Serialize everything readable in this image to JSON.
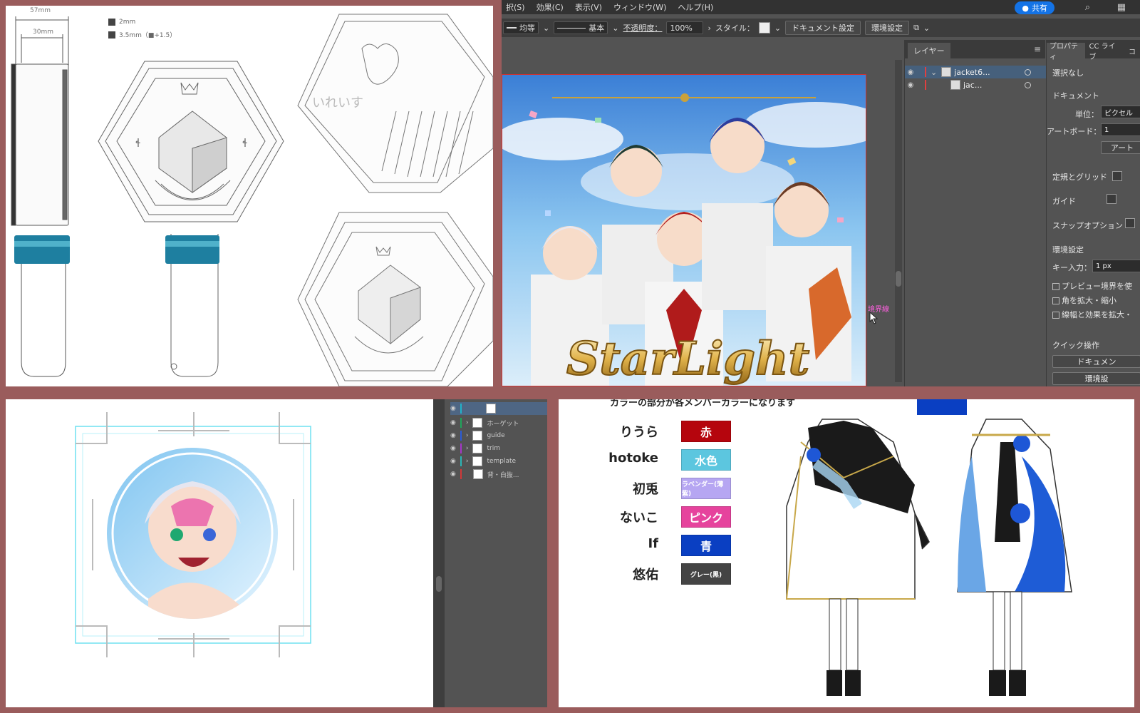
{
  "drawing": {
    "dim_top": "57mm",
    "dim_inner": "30mm",
    "legend": [
      {
        "label": "2mm"
      },
      {
        "label": "3.5mm（■+1.5）"
      }
    ],
    "emboss_text": "いれいす"
  },
  "illustrator": {
    "menu": [
      "択(S)",
      "効果(C)",
      "表示(V)",
      "ウィンドウ(W)",
      "ヘルプ(H)"
    ],
    "share_label": "共有",
    "control_bar": {
      "stroke_profile": "均等",
      "brush": "基本",
      "opacity_label": "不透明度：",
      "opacity_value": "100%",
      "style_label": "スタイル：",
      "doc_settings": "ドキュメント設定",
      "preferences": "環境設定"
    },
    "artwork": {
      "title": "StarLight",
      "boundary_label": "境界線"
    },
    "layers": {
      "tab": "レイヤー",
      "rows": [
        {
          "name": "jacket6..."
        },
        {
          "name": "jac..."
        }
      ]
    },
    "properties": {
      "tabs": [
        "プロパティ",
        "CC ライブ",
        "コ"
      ],
      "no_selection": "選択なし",
      "document": "ドキュメント",
      "unit_label": "単位：",
      "unit_value": "ピクセル",
      "artboard_label": "アートボード：",
      "artboard_value": "1",
      "artboard_button": "アート",
      "rulers_grid": "定規とグリッド",
      "guides": "ガイド",
      "snap": "スナップオプション",
      "prefs": "環境設定",
      "key_input_label": "キー入力：",
      "key_input_value": "1 px",
      "checks": [
        "プレビュー境界を使",
        "角を拡大・縮小",
        "線幅と効果を拡大・"
      ],
      "quick_actions": "クイック操作",
      "doc_button": "ドキュメン",
      "prefs_button": "環境設"
    },
    "colors": {
      "accent": "#1473e6",
      "ui_dark": "#535353"
    }
  },
  "layers_strip": {
    "rows": [
      {
        "name": "",
        "color": "#21b3c9"
      },
      {
        "name": "ホーゲット",
        "color": "#1fa55b"
      },
      {
        "name": "guide",
        "color": "#2a5bd7"
      },
      {
        "name": "trim",
        "color": "#a635c9"
      },
      {
        "name": "template",
        "color": "#2bb5b5"
      },
      {
        "name": "背・白抜...",
        "color": "#d23838"
      }
    ]
  },
  "costume": {
    "header": "カラーの部分が各メンバーカラーになります",
    "members": [
      {
        "name": "りうら",
        "color_label": "赤",
        "hex": "#b5050d",
        "small": false
      },
      {
        "name": "hotoke",
        "color_label": "水色",
        "hex": "#5cc6df",
        "small": false
      },
      {
        "name": "初兎",
        "color_label": "ラベンダー(薄紫)",
        "hex": "#b6a6f2",
        "small": true
      },
      {
        "name": "ないこ",
        "color_label": "ピンク",
        "hex": "#e6439d",
        "small": false
      },
      {
        "name": "If",
        "color_label": "青",
        "hex": "#0a3fc2",
        "small": false
      },
      {
        "name": "悠佑",
        "color_label": "グレー(黒)",
        "hex": "#444444",
        "small": true
      }
    ]
  }
}
